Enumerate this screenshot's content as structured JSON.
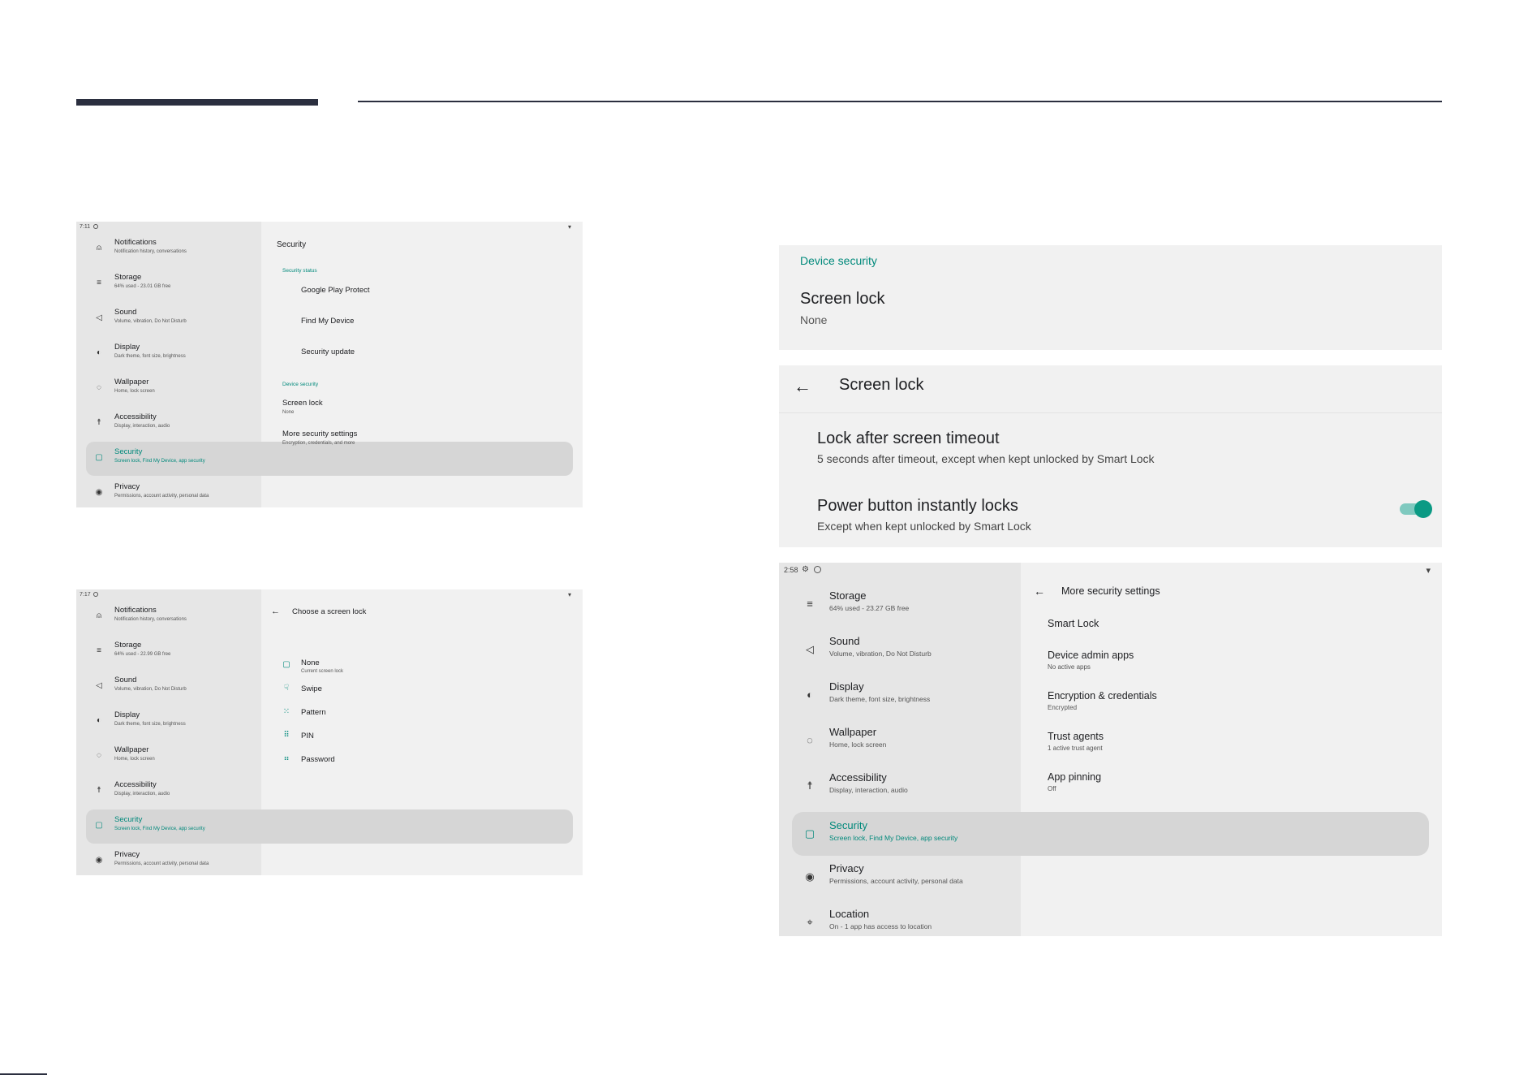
{
  "shot1": {
    "status": {
      "time": "7:11"
    },
    "sidebar": [
      {
        "title": "Notifications",
        "sub": "Notification history, conversations",
        "icon": "bell-icon"
      },
      {
        "title": "Storage",
        "sub": "64% used - 23.01 GB free",
        "icon": "storage-icon"
      },
      {
        "title": "Sound",
        "sub": "Volume, vibration, Do Not Disturb",
        "icon": "volume-icon"
      },
      {
        "title": "Display",
        "sub": "Dark theme, font size, brightness",
        "icon": "brightness-icon"
      },
      {
        "title": "Wallpaper",
        "sub": "Home, lock screen",
        "icon": "palette-icon"
      },
      {
        "title": "Accessibility",
        "sub": "Display, interaction, audio",
        "icon": "accessibility-icon"
      },
      {
        "title": "Security",
        "sub": "Screen lock, Find My Device, app security",
        "icon": "lock-icon"
      },
      {
        "title": "Privacy",
        "sub": "Permissions, account activity, personal data",
        "icon": "privacy-icon"
      }
    ],
    "main": {
      "title": "Security",
      "section_status": "Security status",
      "status_items": [
        "Google Play Protect",
        "Find My Device",
        "Security update"
      ],
      "section_device": "Device security",
      "screen_lock": {
        "title": "Screen lock",
        "sub": "None"
      },
      "more": {
        "title": "More security settings",
        "sub": "Encryption, credentials, and more"
      }
    }
  },
  "shot2": {
    "status": {
      "time": "7:17"
    },
    "sidebar": [
      {
        "title": "Notifications",
        "sub": "Notification history, conversations",
        "icon": "bell-icon"
      },
      {
        "title": "Storage",
        "sub": "64% used - 22.99 GB free",
        "icon": "storage-icon"
      },
      {
        "title": "Sound",
        "sub": "Volume, vibration, Do Not Disturb",
        "icon": "volume-icon"
      },
      {
        "title": "Display",
        "sub": "Dark theme, font size, brightness",
        "icon": "brightness-icon"
      },
      {
        "title": "Wallpaper",
        "sub": "Home, lock screen",
        "icon": "palette-icon"
      },
      {
        "title": "Accessibility",
        "sub": "Display, interaction, audio",
        "icon": "accessibility-icon"
      },
      {
        "title": "Security",
        "sub": "Screen lock, Find My Device, app security",
        "icon": "lock-icon"
      },
      {
        "title": "Privacy",
        "sub": "Permissions, account activity, personal data",
        "icon": "privacy-icon"
      }
    ],
    "main": {
      "title": "Choose a screen lock",
      "options": [
        {
          "label": "None",
          "sub": "Current screen lock",
          "icon": "lock-icon"
        },
        {
          "label": "Swipe",
          "icon": "swipe-icon"
        },
        {
          "label": "Pattern",
          "icon": "pattern-icon"
        },
        {
          "label": "PIN",
          "icon": "pin-icon"
        },
        {
          "label": "Password",
          "icon": "password-icon"
        }
      ]
    }
  },
  "panel_device": {
    "section": "Device security",
    "title": "Screen lock",
    "sub": "None"
  },
  "panel_screenlock": {
    "title": "Screen lock",
    "items": [
      {
        "title": "Lock after screen timeout",
        "sub": "5 seconds after timeout, except when kept unlocked by Smart Lock"
      },
      {
        "title": "Power button instantly locks",
        "sub": "Except when kept unlocked by Smart Lock",
        "toggle": true
      }
    ]
  },
  "shot3": {
    "status": {
      "time": "2:58"
    },
    "sidebar": [
      {
        "title": "Storage",
        "sub": "64% used - 23.27 GB free",
        "icon": "storage-icon"
      },
      {
        "title": "Sound",
        "sub": "Volume, vibration, Do Not Disturb",
        "icon": "volume-icon"
      },
      {
        "title": "Display",
        "sub": "Dark theme, font size, brightness",
        "icon": "brightness-icon"
      },
      {
        "title": "Wallpaper",
        "sub": "Home, lock screen",
        "icon": "palette-icon"
      },
      {
        "title": "Accessibility",
        "sub": "Display, interaction, audio",
        "icon": "accessibility-icon"
      },
      {
        "title": "Security",
        "sub": "Screen lock, Find My Device, app security",
        "icon": "lock-icon"
      },
      {
        "title": "Privacy",
        "sub": "Permissions, account activity, personal data",
        "icon": "privacy-icon"
      },
      {
        "title": "Location",
        "sub": "On - 1 app has access to location",
        "icon": "location-icon"
      }
    ],
    "main": {
      "title": "More security settings",
      "items": [
        {
          "title": "Smart Lock",
          "sub": ""
        },
        {
          "title": "Device admin apps",
          "sub": "No active apps"
        },
        {
          "title": "Encryption & credentials",
          "sub": "Encrypted"
        },
        {
          "title": "Trust agents",
          "sub": "1 active trust agent"
        },
        {
          "title": "App pinning",
          "sub": "Off"
        }
      ]
    }
  },
  "colors": {
    "accent": "#00897b",
    "toggle_on": "#0b9a84",
    "header_bar": "#2b2f3f"
  }
}
